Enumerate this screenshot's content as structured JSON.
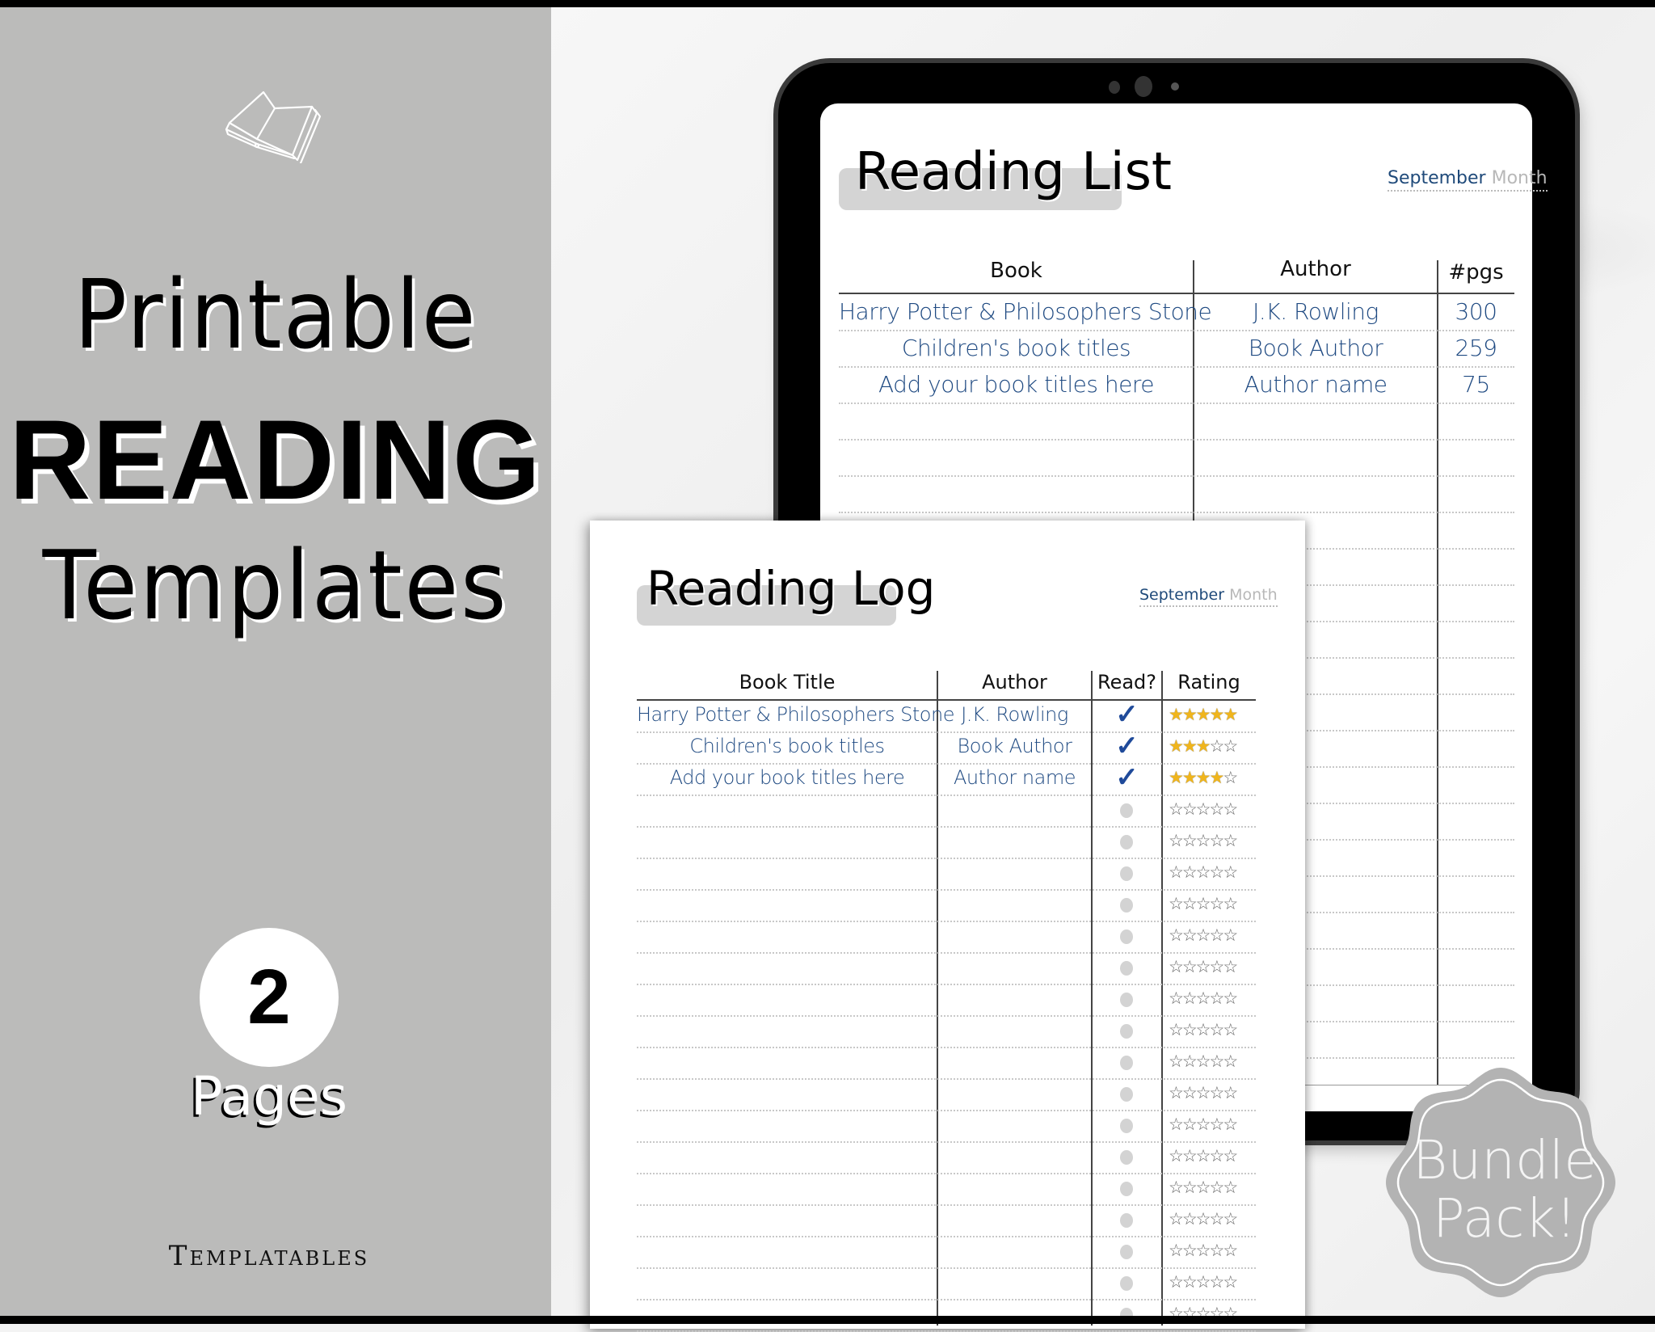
{
  "cover": {
    "title_line1": "Printable",
    "title_line2": "READING",
    "title_line3": "Templates",
    "page_count": "2",
    "page_count_label": "Pages",
    "brand": "Templatables",
    "icon": "open-book-icon",
    "panel_color": "#bbbbba"
  },
  "badge": {
    "line1": "Bundle",
    "line2": "Pack!",
    "color": "#b3b3b3"
  },
  "reading_list": {
    "title": "Reading List",
    "month_value": "September",
    "month_label": "Month",
    "columns": [
      "Book",
      "Author",
      "#pgs"
    ],
    "rows": [
      {
        "book": "Harry Potter & Philosophers Stone",
        "author": "J.K. Rowling",
        "pages": "300"
      },
      {
        "book": "Children's book titles",
        "author": "Book Author",
        "pages": "259"
      },
      {
        "book": "Add your book titles here",
        "author": "Author name",
        "pages": "75"
      }
    ],
    "text_color": "#1f4a82"
  },
  "reading_log": {
    "title": "Reading Log",
    "month_value": "September",
    "month_label": "Month",
    "columns": [
      "Book Title",
      "Author",
      "Read?",
      "Rating"
    ],
    "rows": [
      {
        "title": "Harry Potter & Philosophers Stone",
        "author": "J.K. Rowling",
        "read": true,
        "rating": 5
      },
      {
        "title": "Children's book titles",
        "author": "Book Author",
        "read": true,
        "rating": 3
      },
      {
        "title": "Add your book titles here",
        "author": "Author name",
        "read": true,
        "rating": 4
      }
    ],
    "rating_max": 5,
    "check_glyph": "✓",
    "star_glyph": "★",
    "star_empty_glyph": "☆",
    "star_color": "#f0b51c"
  }
}
